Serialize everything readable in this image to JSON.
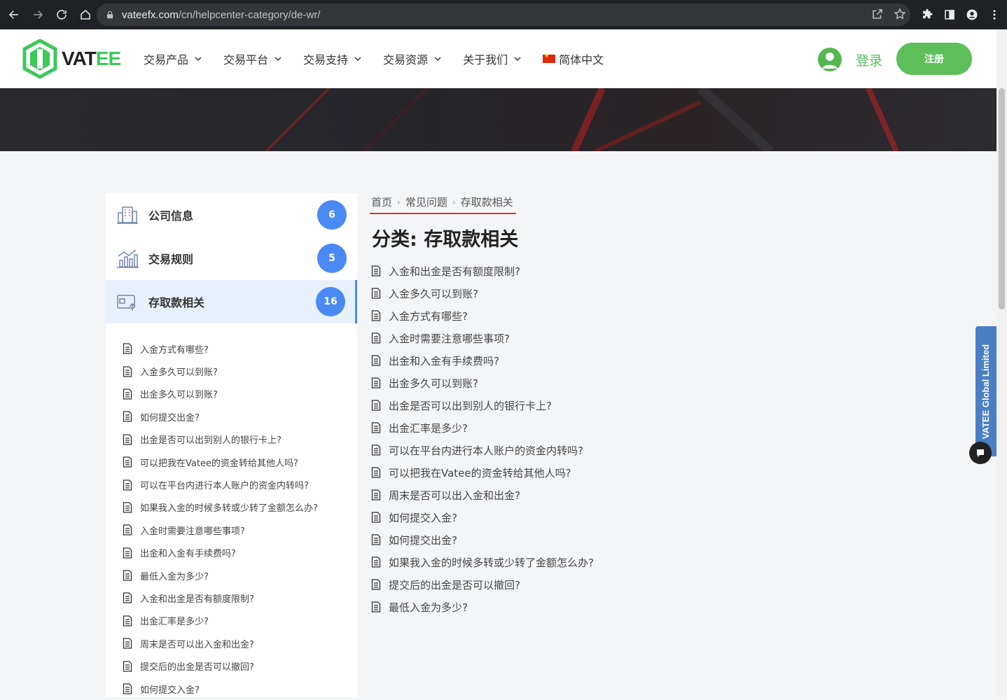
{
  "browser": {
    "url_host": "vateefx.com",
    "url_path": "/cn/helpcenter-category/de-wr/"
  },
  "header": {
    "logo_text_a": "VAT",
    "logo_text_b": "EE",
    "menu": [
      {
        "label": "交易产品"
      },
      {
        "label": "交易平台"
      },
      {
        "label": "交易支持"
      },
      {
        "label": "交易资源"
      },
      {
        "label": "关于我们"
      }
    ],
    "language": "简体中文",
    "login_label": "登录",
    "register_label": "注册",
    "brand_green": "#52c15a"
  },
  "sidebar": {
    "categories": [
      {
        "label": "公司信息",
        "count": "6",
        "icon": "building-icon"
      },
      {
        "label": "交易规则",
        "count": "5",
        "icon": "chart-icon"
      },
      {
        "label": "存取款相关",
        "count": "16",
        "icon": "wallet-icon"
      }
    ],
    "sub_items": [
      "入金方式有哪些?",
      "入金多久可以到账?",
      "出金多久可以到账?",
      "如何提交出金?",
      "出金是否可以出到别人的银行卡上?",
      "可以把我在Vatee的资金转给其他人吗?",
      "可以在平台内进行本人账户的资金内转吗?",
      "如果我入金的时候多转或少转了金额怎么办?",
      "入金时需要注意哪些事项?",
      "出金和入金有手续费吗?",
      "最低入金为多少?",
      "入金和出金是否有额度限制?",
      "出金汇率是多少?",
      "周末是否可以出入金和出金?",
      "提交后的出金是否可以撤回?",
      "如何提交入金?"
    ]
  },
  "main": {
    "breadcrumb": [
      "首页",
      "常见问题",
      "存取款相关"
    ],
    "title": "分类: 存取款相关",
    "articles": [
      "入金和出金是否有额度限制?",
      "入金多久可以到账?",
      "入金方式有哪些?",
      "入金时需要注意哪些事项?",
      "出金和入金有手续费吗?",
      "出金多久可以到账?",
      "出金是否可以出到别人的银行卡上?",
      "出金汇率是多少?",
      "可以在平台内进行本人账户的资金内转吗?",
      "可以把我在Vatee的资金转给其他人吗?",
      "周末是否可以出入金和出金?",
      "如何提交入金?",
      "如何提交出金?",
      "如果我入金的时候多转或少转了金额怎么办?",
      "提交后的出金是否可以撤回?",
      "最低入金为多少?"
    ]
  },
  "floating": {
    "side_tab": "VATEE Global Limited"
  }
}
